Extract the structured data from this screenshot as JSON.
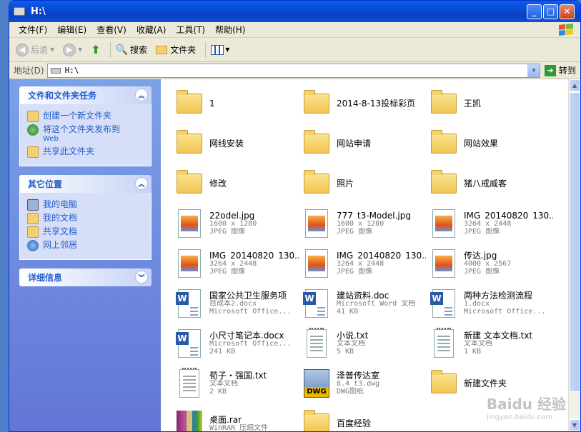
{
  "window": {
    "title": "H:\\"
  },
  "menu": [
    "文件(F)",
    "编辑(E)",
    "查看(V)",
    "收藏(A)",
    "工具(T)",
    "帮助(H)"
  ],
  "toolbar": {
    "back": "后退",
    "search": "搜索",
    "folders": "文件夹"
  },
  "address": {
    "label": "地址(D)",
    "value": "H:\\",
    "go": "转到"
  },
  "tasks": {
    "title": "文件和文件夹任务",
    "items": [
      {
        "label": "创建一个新文件夹"
      },
      {
        "label": "将这个文件夹发布到",
        "sub": "Web"
      },
      {
        "label": "共享此文件夹"
      }
    ]
  },
  "places": {
    "title": "其它位置",
    "items": [
      {
        "label": "我的电脑"
      },
      {
        "label": "我的文档"
      },
      {
        "label": "共享文档"
      },
      {
        "label": "网上邻居"
      }
    ]
  },
  "details": {
    "title": "详细信息"
  },
  "files": [
    {
      "type": "folder",
      "name": "1"
    },
    {
      "type": "folder",
      "name": "2014-8-13投标彩页"
    },
    {
      "type": "folder",
      "name": "王凯"
    },
    {
      "type": "folder",
      "name": "网线安装"
    },
    {
      "type": "folder",
      "name": "网站申请"
    },
    {
      "type": "folder",
      "name": "网站效果"
    },
    {
      "type": "folder",
      "name": "修改"
    },
    {
      "type": "folder",
      "name": "照片"
    },
    {
      "type": "folder",
      "name": "猪八戒威客"
    },
    {
      "type": "jpg",
      "name": "22odel.jpg",
      "l1": "1600 x 1280",
      "l2": "JPEG 图像"
    },
    {
      "type": "jpg",
      "name": "777_t3-Model.jpg",
      "l1": "1600 x 1280",
      "l2": "JPEG 图像"
    },
    {
      "type": "jpg",
      "name": "IMG_20140820_130...",
      "l1": "3264 x 2448",
      "l2": "JPEG 图像"
    },
    {
      "type": "jpg",
      "name": "IMG_20140820_130...",
      "l1": "3264 x 2448",
      "l2": "JPEG 图像"
    },
    {
      "type": "jpg",
      "name": "IMG_20140820_130...",
      "l1": "3264 x 2448",
      "l2": "JPEG 图像"
    },
    {
      "type": "jpg",
      "name": "传达.jpg",
      "l1": "4000 x 2567",
      "l2": "JPEG 图像"
    },
    {
      "type": "doc",
      "name": "国家公共卫生服务项",
      "l1": "目成本2.docx",
      "l2": "Microsoft Office..."
    },
    {
      "type": "doc",
      "name": "建站资料.doc",
      "l1": "Microsoft Word 文档",
      "l2": "41 KB"
    },
    {
      "type": "doc",
      "name": "两种方法检测流程",
      "l1": "1.docx",
      "l2": "Microsoft Office..."
    },
    {
      "type": "doc",
      "name": "小尺寸笔记本.docx",
      "l1": "Microsoft Office...",
      "l2": "241 KB"
    },
    {
      "type": "txt",
      "name": "小说.txt",
      "l1": "文本文档",
      "l2": "5 KB"
    },
    {
      "type": "txt",
      "name": "新建 文本文档.txt",
      "l1": "文本文档",
      "l2": "1 KB"
    },
    {
      "type": "txt",
      "name": "荀子・强国.txt",
      "l1": "文本文档",
      "l2": "2 KB"
    },
    {
      "type": "dwg",
      "name": "泽普传达室",
      "l1": "8.4_t3.dwg",
      "l2": "DWG图纸"
    },
    {
      "type": "folder",
      "name": "新建文件夹"
    },
    {
      "type": "rar",
      "name": "桌面.rar",
      "l1": "WinRAR 压缩文件",
      "l2": ""
    },
    {
      "type": "folder",
      "name": "百度经验"
    }
  ],
  "watermark": {
    "text": "Baidu 经验",
    "sub": "jingyan.baidu.com"
  }
}
